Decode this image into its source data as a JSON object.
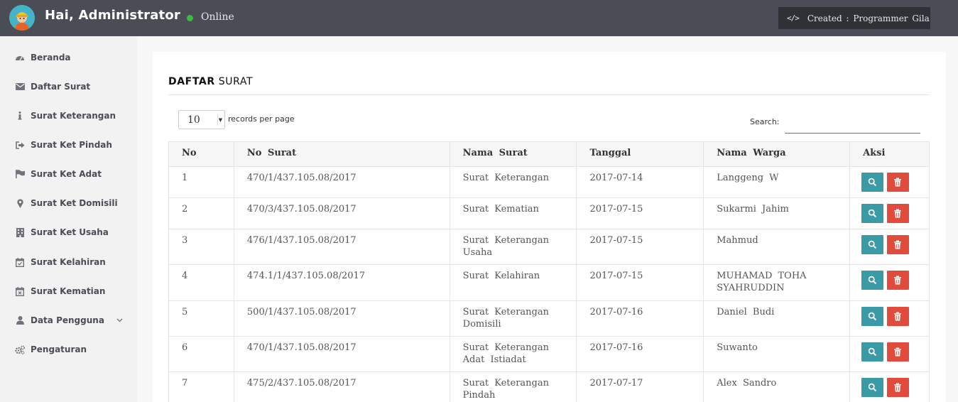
{
  "header": {
    "greeting": "Hai, Administrator",
    "status": "Online",
    "credit": "Created : Programmer Gila",
    "icons": {
      "avatar": "avatar-icon",
      "credit": "code-icon"
    },
    "colors": {
      "topbar": "#4a4d56",
      "status_online": "#3bbb3f"
    }
  },
  "sidebar": {
    "items": [
      {
        "label": "Beranda",
        "icon": "dashboard-icon"
      },
      {
        "label": "Daftar Surat",
        "icon": "envelope-icon"
      },
      {
        "label": "Surat Keterangan",
        "icon": "info-icon"
      },
      {
        "label": "Surat Ket Pindah",
        "icon": "sign-out-icon"
      },
      {
        "label": "Surat Ket Adat",
        "icon": "flag-icon"
      },
      {
        "label": "Surat Ket Domisili",
        "icon": "map-marker-icon"
      },
      {
        "label": "Surat Ket Usaha",
        "icon": "building-icon"
      },
      {
        "label": "Surat Kelahiran",
        "icon": "calendar-check-icon"
      },
      {
        "label": "Surat Kematian",
        "icon": "calendar-times-icon"
      },
      {
        "label": "Data Pengguna",
        "icon": "user-icon",
        "has_submenu": true
      },
      {
        "label": "Pengaturan",
        "icon": "cogs-icon"
      }
    ]
  },
  "panel": {
    "title_bold": "DAFTAR",
    "title_rest": "SURAT",
    "page_length": {
      "selected": "10",
      "label": "records per page"
    },
    "search": {
      "label": "Search:",
      "value": ""
    }
  },
  "table": {
    "columns": [
      "No",
      "No  Surat",
      "Nama  Surat",
      "Tanggal",
      "Nama  Warga",
      "Aksi"
    ],
    "rows": [
      {
        "no": "1",
        "no_surat": "470/1/437.105.08/2017",
        "nama_surat": "Surat  Keterangan",
        "tanggal": "2017-07-14",
        "nama_warga": "Langgeng  W"
      },
      {
        "no": "2",
        "no_surat": "470/3/437.105.08/2017",
        "nama_surat": "Surat  Kematian",
        "tanggal": "2017-07-15",
        "nama_warga": "Sukarmi  Jahim"
      },
      {
        "no": "3",
        "no_surat": "476/1/437.105.08/2017",
        "nama_surat": "Surat  Keterangan  Usaha",
        "tanggal": "2017-07-15",
        "nama_warga": "Mahmud"
      },
      {
        "no": "4",
        "no_surat": "474.1/1/437.105.08/2017",
        "nama_surat": "Surat  Kelahiran",
        "tanggal": "2017-07-15",
        "nama_warga": "MUHAMAD  TOHA  SYAHRUDDIN"
      },
      {
        "no": "5",
        "no_surat": "500/1/437.105.08/2017",
        "nama_surat": "Surat  Keterangan  Domisili",
        "tanggal": "2017-07-16",
        "nama_warga": "Daniel  Budi"
      },
      {
        "no": "6",
        "no_surat": "470/1/437.105.08/2017",
        "nama_surat": "Surat  Keterangan  Adat  Istiadat",
        "tanggal": "2017-07-16",
        "nama_warga": "Suwanto"
      },
      {
        "no": "7",
        "no_surat": "475/2/437.105.08/2017",
        "nama_surat": "Surat  Keterangan  Pindah",
        "tanggal": "2017-07-17",
        "nama_warga": "Alex  Sandro"
      }
    ],
    "actions": {
      "view": {
        "icon": "search-icon",
        "color": "#3a9aa6"
      },
      "delete": {
        "icon": "trash-icon",
        "color": "#e14b3b"
      }
    }
  }
}
